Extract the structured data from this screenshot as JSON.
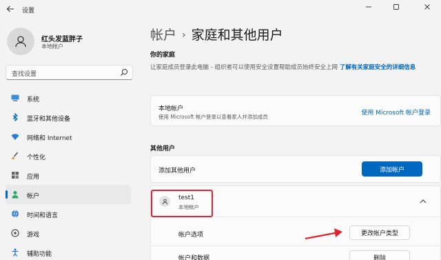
{
  "window": {
    "title": "设置",
    "controls": [
      "minimize",
      "maximize",
      "close"
    ]
  },
  "user": {
    "name": "红头发蓝胖子",
    "type": "本地帐户"
  },
  "search": {
    "placeholder": "查找设置"
  },
  "nav": [
    {
      "label": "系统",
      "icon": "monitor-icon"
    },
    {
      "label": "蓝牙和其他设备",
      "icon": "bluetooth-icon"
    },
    {
      "label": "网络和 Internet",
      "icon": "wifi-icon"
    },
    {
      "label": "个性化",
      "icon": "brush-icon"
    },
    {
      "label": "应用",
      "icon": "apps-icon"
    },
    {
      "label": "帐户",
      "icon": "person-icon",
      "active": true
    },
    {
      "label": "时间和语言",
      "icon": "globe-clock-icon"
    },
    {
      "label": "游戏",
      "icon": "gamepad-icon"
    },
    {
      "label": "辅助功能",
      "icon": "accessibility-icon"
    }
  ],
  "breadcrumb": {
    "parent": "帐户",
    "separator": "›",
    "current": "家庭和其他用户"
  },
  "family": {
    "heading": "你的家庭",
    "description": "让家庭成员登录此电脑 - 组织者可以使用安全设置帮助成员始终安全上网",
    "link": "了解有关家庭安全的详细信息",
    "local_account_title": "本地帐户",
    "local_account_desc": "使用 Microsoft 帐户登录以查看家人并添加成员",
    "signin_link": "使用 Microsoft 帐户登录"
  },
  "others": {
    "heading": "其他用户",
    "add_label": "添加其他用户",
    "add_button": "添加帐户",
    "user_name": "test1",
    "user_type": "本地帐户",
    "option_label": "帐户选项",
    "option_button": "更改帐户类型",
    "data_label": "帐户和数据",
    "data_button": "删除"
  },
  "colors": {
    "accent": "#0067c0",
    "annotation": "#e0242f"
  }
}
